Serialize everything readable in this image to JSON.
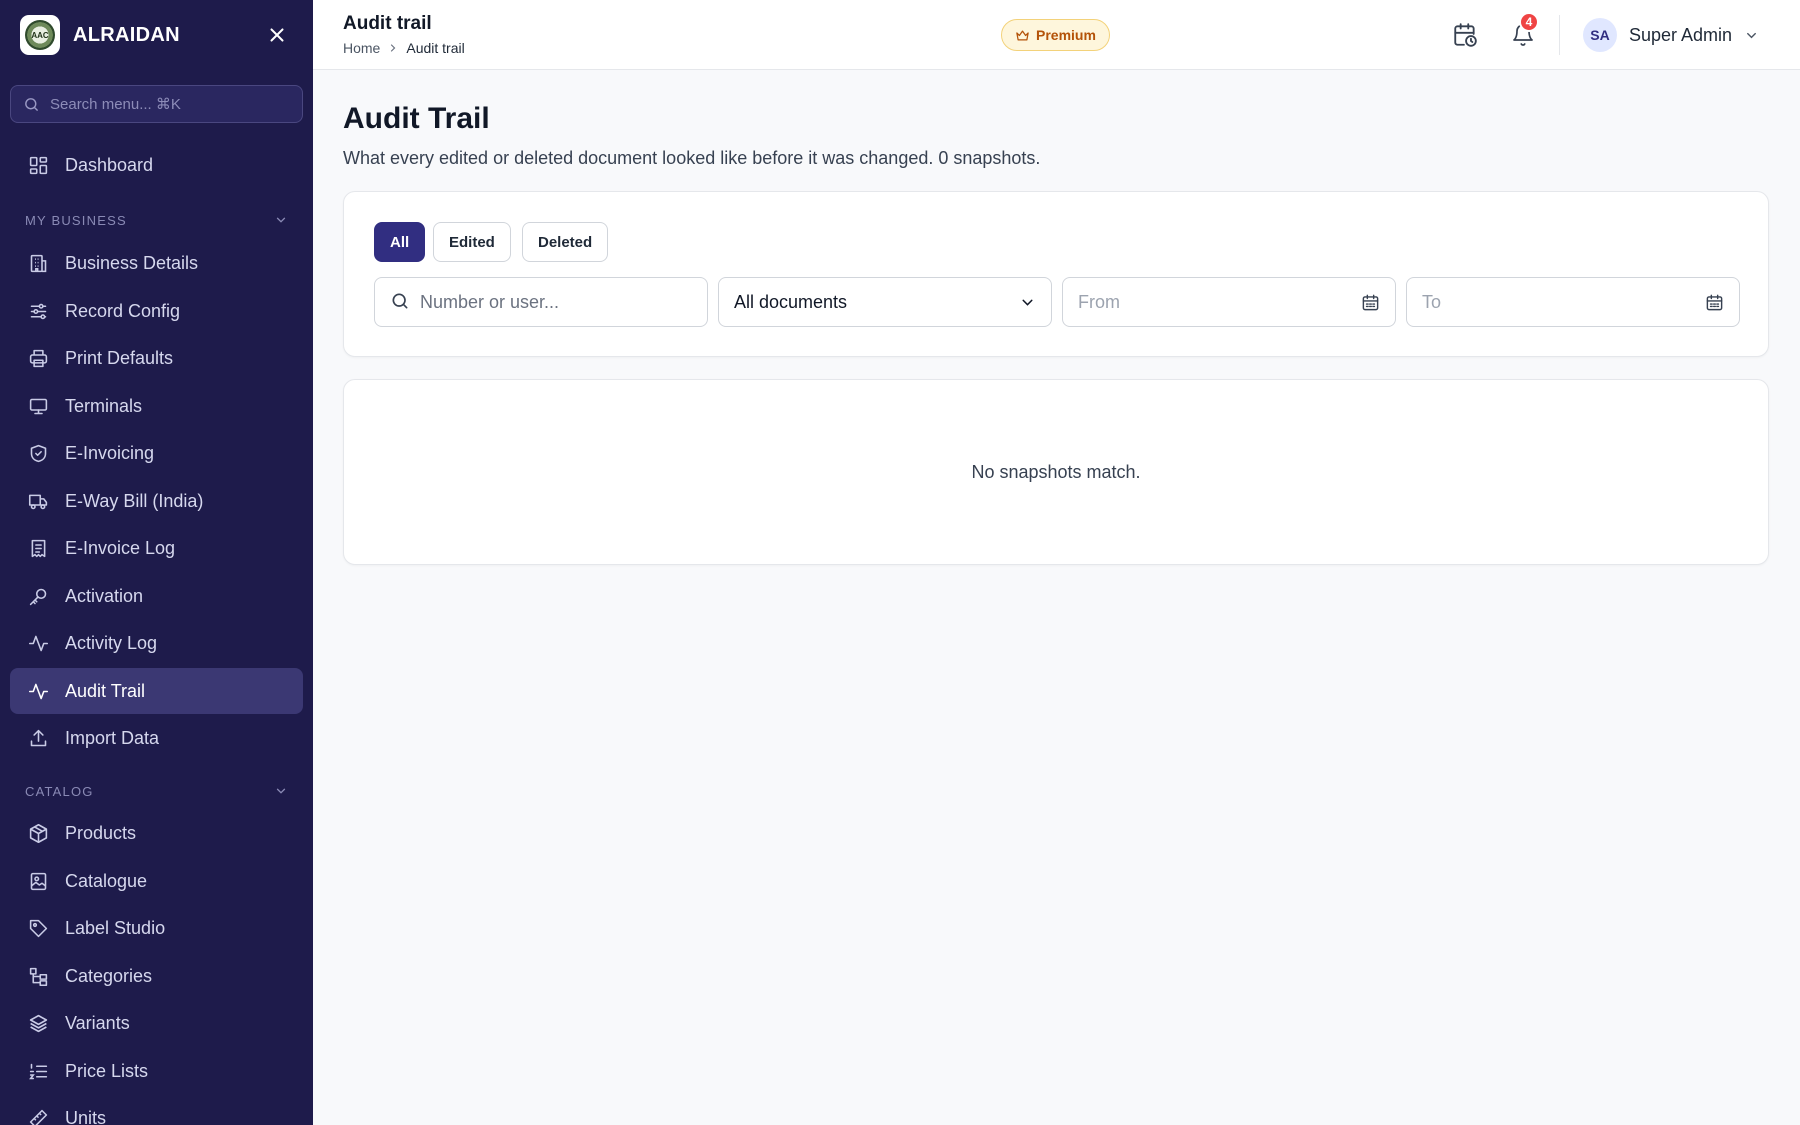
{
  "brand": {
    "name": "ALRAIDAN",
    "logo_text": "AAC"
  },
  "sidebar": {
    "search_placeholder": "Search menu... ⌘K",
    "dashboard": {
      "label": "Dashboard",
      "icon": "grid-icon"
    },
    "sections": [
      {
        "title": "MY BUSINESS",
        "items": [
          {
            "label": "Business Details",
            "icon": "building-icon"
          },
          {
            "label": "Record Config",
            "icon": "sliders-icon"
          },
          {
            "label": "Print Defaults",
            "icon": "printer-icon"
          },
          {
            "label": "Terminals",
            "icon": "monitor-icon"
          },
          {
            "label": "E-Invoicing",
            "icon": "shield-check-icon"
          },
          {
            "label": "E-Way Bill (India)",
            "icon": "truck-icon"
          },
          {
            "label": "E-Invoice Log",
            "icon": "receipt-icon"
          },
          {
            "label": "Activation",
            "icon": "key-icon"
          },
          {
            "label": "Activity Log",
            "icon": "activity-icon"
          },
          {
            "label": "Audit Trail",
            "icon": "activity-icon",
            "active": true
          },
          {
            "label": "Import Data",
            "icon": "upload-icon"
          }
        ]
      },
      {
        "title": "CATALOG",
        "items": [
          {
            "label": "Products",
            "icon": "box-icon"
          },
          {
            "label": "Catalogue",
            "icon": "image-icon"
          },
          {
            "label": "Label Studio",
            "icon": "tag-icon"
          },
          {
            "label": "Categories",
            "icon": "tree-icon"
          },
          {
            "label": "Variants",
            "icon": "layers-icon"
          },
          {
            "label": "Price Lists",
            "icon": "list-ordered-icon"
          },
          {
            "label": "Units",
            "icon": "ruler-icon"
          }
        ]
      }
    ]
  },
  "header": {
    "title": "Audit trail",
    "breadcrumb": [
      "Home",
      "Audit trail"
    ],
    "premium_label": "Premium",
    "notification_count": "4",
    "user": {
      "initials": "SA",
      "name": "Super Admin"
    }
  },
  "main": {
    "title": "Audit Trail",
    "subtitle": "What every edited or deleted document looked like before it was changed. 0 snapshots.",
    "filter_tabs": [
      {
        "label": "All",
        "active": true
      },
      {
        "label": "Edited",
        "active": false
      },
      {
        "label": "Deleted",
        "active": false
      }
    ],
    "search_placeholder": "Number or user...",
    "document_select": "All documents",
    "from_placeholder": "From",
    "to_placeholder": "To",
    "empty_message": "No snapshots match."
  },
  "colors": {
    "sidebar_bg": "#1e1b4b",
    "accent": "#312e81",
    "badge": "#ef4444",
    "premium": "#b45309"
  }
}
